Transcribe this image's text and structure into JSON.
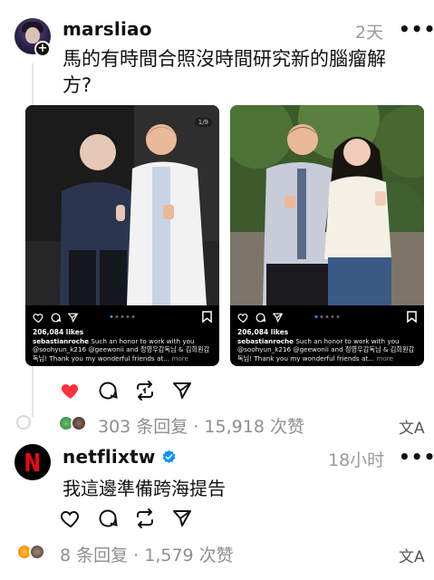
{
  "post1": {
    "username": "marsliao",
    "time": "2天",
    "more_label": "•••",
    "text": "馬的有時間合照沒時間研究新的腦瘤解方?",
    "liked": true,
    "stats": "303 条回复 · 15,918 次赞",
    "translate_icon": "文A",
    "cards": [
      {
        "counter": "1/9",
        "likes": "206,084 likes",
        "caption_user": "sebastianroche",
        "caption_text": " Such an honor to work with you @soohyun_k216 @geewonii and 정영우감독님 & 김희원감독님! Thank you my wonderful friends at...",
        "caption_more": " more"
      },
      {
        "counter": "",
        "likes": "206,084 likes",
        "caption_user": "sebastianroche",
        "caption_text": " Such an honor to work with you @soohyun_k216 @geewonii and 정영우감독님 & 김희원감독님! Thank you my wonderful friends at...",
        "caption_more": " more"
      }
    ]
  },
  "post2": {
    "username": "netflixtw",
    "time": "18小时",
    "more_label": "•••",
    "avatar_letter": "N",
    "text": "我這邊準備跨海提告",
    "stats": "8 条回复 · 1,579 次赞",
    "translate_icon": "文A"
  },
  "colors": {
    "like_red": "#ff3040",
    "verified_blue": "#0095f6",
    "netflix_red": "#e50914",
    "muted_text": "#8e8e8e"
  },
  "icons": [
    "heart-icon",
    "comment-icon",
    "repost-icon",
    "share-icon",
    "translate-icon",
    "verified-icon",
    "plus-icon",
    "bookmark-icon"
  ]
}
